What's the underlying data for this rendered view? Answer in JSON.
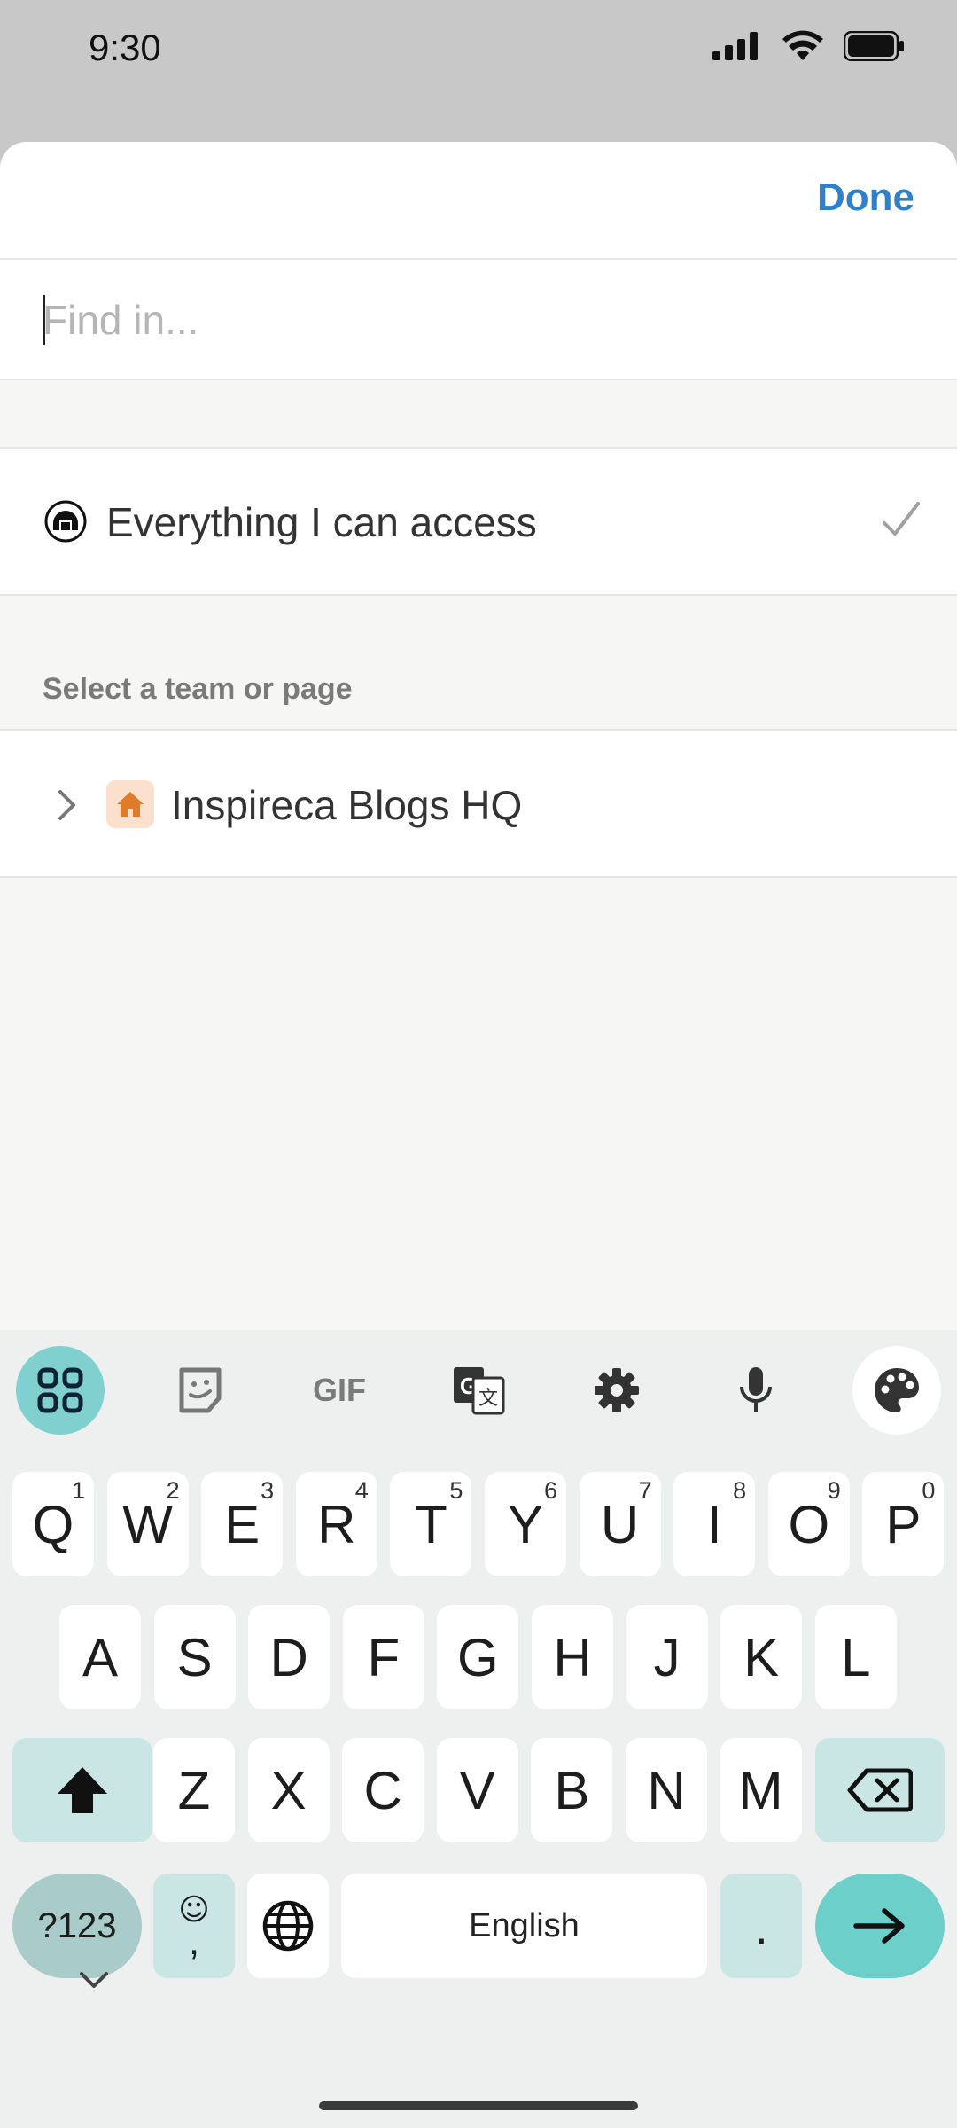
{
  "status_bar": {
    "time": "9:30",
    "icons": [
      "signal-icon",
      "wifi-icon",
      "battery-icon"
    ]
  },
  "header": {
    "done_label": "Done"
  },
  "search": {
    "placeholder": "Find in...",
    "value": ""
  },
  "scope": {
    "label": "Everything I can access",
    "icon": "workspace-icon",
    "selected": true
  },
  "teams": {
    "section_label": "Select a team or page",
    "items": [
      {
        "label": "Inspireca Blogs HQ",
        "icon": "home-icon",
        "expanded": false
      }
    ]
  },
  "keyboard": {
    "toolbar": [
      "apps-grid-icon",
      "sticker-icon",
      "gif-icon",
      "translate-icon",
      "settings-icon",
      "microphone-icon",
      "palette-icon"
    ],
    "gif_label": "GIF",
    "row1": [
      {
        "k": "Q",
        "h": "1"
      },
      {
        "k": "W",
        "h": "2"
      },
      {
        "k": "E",
        "h": "3"
      },
      {
        "k": "R",
        "h": "4"
      },
      {
        "k": "T",
        "h": "5"
      },
      {
        "k": "Y",
        "h": "6"
      },
      {
        "k": "U",
        "h": "7"
      },
      {
        "k": "I",
        "h": "8"
      },
      {
        "k": "O",
        "h": "9"
      },
      {
        "k": "P",
        "h": "0"
      }
    ],
    "row2": [
      "A",
      "S",
      "D",
      "F",
      "G",
      "H",
      "J",
      "K",
      "L"
    ],
    "row3": [
      "Z",
      "X",
      "C",
      "V",
      "B",
      "N",
      "M"
    ],
    "symbols_label": "?123",
    "emoji_label": "☺",
    "comma_label": ",",
    "space_label": "English",
    "period_label": ".",
    "accent_color": "#6ccfc9"
  }
}
